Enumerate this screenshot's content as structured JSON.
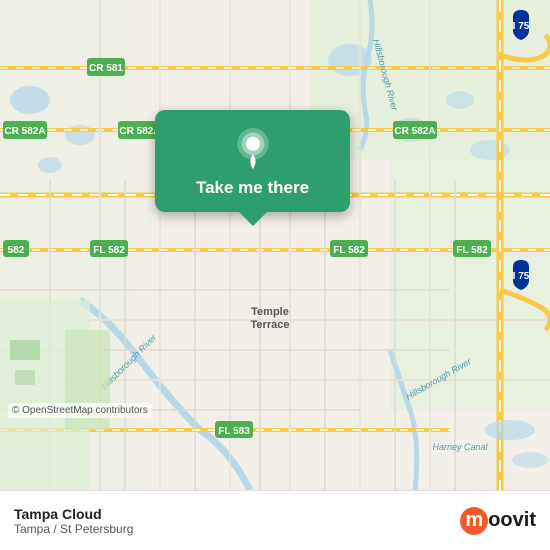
{
  "map": {
    "background_color": "#f2efe9",
    "copyright": "© OpenStreetMap contributors"
  },
  "popup": {
    "label": "Take me there",
    "icon": "location-pin-icon",
    "background_color": "#2e9e6e"
  },
  "bottom_bar": {
    "location_name": "Tampa Cloud",
    "location_sub": "Tampa / St Petersburg",
    "logo_name": "moovit-logo"
  },
  "road_labels": [
    {
      "id": "cr581",
      "text": "CR 581"
    },
    {
      "id": "cr582a_left",
      "text": "CR 582A"
    },
    {
      "id": "cr582a_mid",
      "text": "CR 582A"
    },
    {
      "id": "cr582a_right",
      "text": "CR 582A"
    },
    {
      "id": "fl582_left",
      "text": "FL 582"
    },
    {
      "id": "fl582_mid",
      "text": "FL 582"
    },
    {
      "id": "fl582_right",
      "text": "FL 582"
    },
    {
      "id": "fl582_far",
      "text": "FL 582"
    },
    {
      "id": "i75_top",
      "text": "I 75"
    },
    {
      "id": "i75_bot",
      "text": "I 75"
    },
    {
      "id": "fl583",
      "text": "FL 583"
    },
    {
      "id": "r582",
      "text": "582"
    },
    {
      "id": "hillsborough_top",
      "text": "Hillsborough River"
    },
    {
      "id": "hillsborough_mid",
      "text": "Hillsborough River"
    },
    {
      "id": "temple_terrace",
      "text": "Temple\nTerrace"
    },
    {
      "id": "harney_canal",
      "text": "Harney Canal"
    }
  ]
}
